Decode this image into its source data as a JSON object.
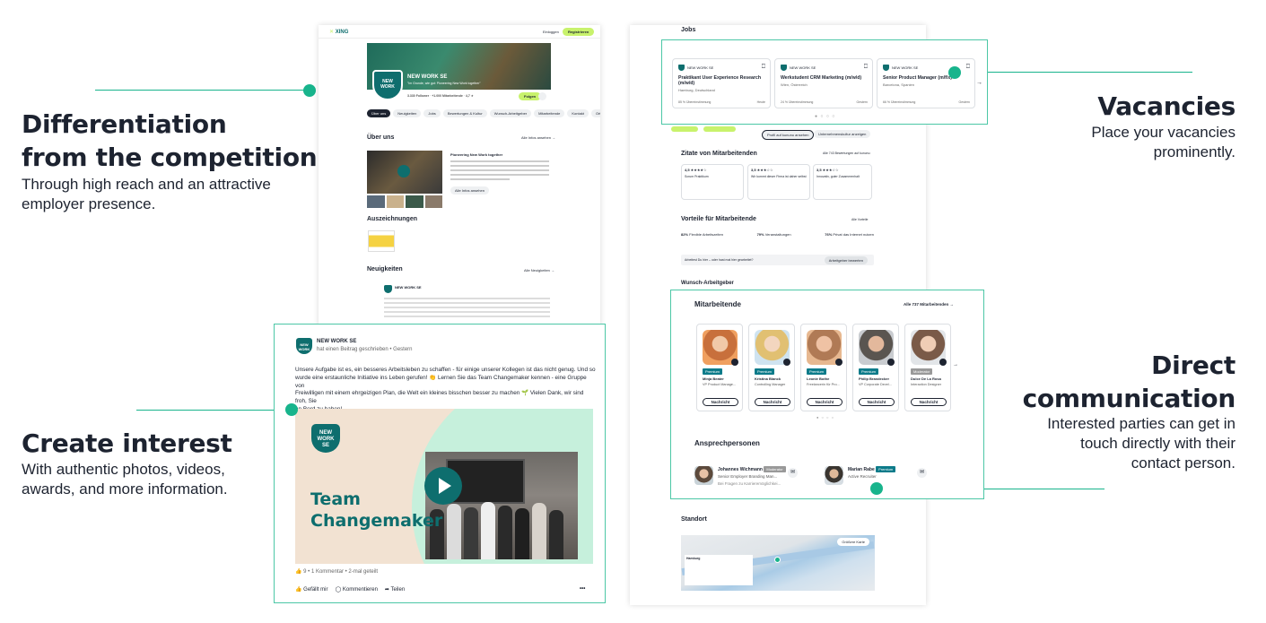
{
  "left_copy": {
    "differentiation": {
      "title_line1": "Differentiation",
      "title_line2": "from the competition",
      "sub_line1": "Through high reach and an attractive",
      "sub_line2": "employer presence."
    },
    "interest": {
      "title": "Create interest",
      "sub_line1": "With authentic photos, videos,",
      "sub_line2": "awards, and more information."
    }
  },
  "right_copy": {
    "vacancies": {
      "title": "Vacancies",
      "sub_line1": "Place your vacancies",
      "sub_line2": "prominently."
    },
    "direct": {
      "title_line1": "Direct",
      "title_line2": "communication",
      "sub_line1": "Interested parties can get in",
      "sub_line2": "touch directly with their",
      "sub_line3": "contact  person."
    }
  },
  "profile_page": {
    "logo": "XING",
    "login": "Einloggen",
    "register": "Registrieren",
    "company": "NEW WORK SE",
    "tagline": "\"Im Grunde, wie gut: Pioneering New Work together\"",
    "followers": "3.330 Follower",
    "employees": "+1.000 Mitarbeitende",
    "rating": "4,7",
    "follow": "Folgen",
    "tabs": [
      "Über uns",
      "Neuigkeiten",
      "Jobs",
      "Bewertungen & Kultur",
      "Wunsch-Arbeitgeber",
      "Mitarbeitende",
      "Kontakt",
      "Ort"
    ],
    "about_title": "Über uns",
    "about_link": "Alle Infos ansehen",
    "about_heading": "Pioneering New Work together",
    "about_more": "Alle Infos ansehen",
    "awards_title": "Auszeichnungen",
    "news_title": "Neuigkeiten",
    "news_link": "Alle Neuigkeiten",
    "news_author": "NEW WORK SE"
  },
  "post": {
    "author": "NEW WORK SE",
    "meta": "hat einen Beitrag geschrieben",
    "time": "Gestern",
    "body_line1": "Unsere Aufgabe ist es, ein besseres Arbeitsleben zu schaffen - für einige unserer Kollegen ist das nicht genug. Und so",
    "body_line2": "wurde eine erstaunliche Initiative ins Leben gerufen! 👏 Lernen Sie das Team Changemaker kennen - eine Gruppe von",
    "body_line3": "Freiwilligen mit einem ehrgeizigen Plan, die Welt ein kleines bisschen besser zu machen 🌱 Vielen Dank, wir sind froh, Sie",
    "body_line4": "an Bord zu haben!",
    "video_title_line1": "Team",
    "video_title_line2": "Changemaker",
    "logo_text_1": "NEW",
    "logo_text_2": "WORK",
    "logo_text_3": "SE",
    "reactions": "9",
    "comments": "1 Kommentar",
    "shares": "2-mal geteilt",
    "like": "Gefällt mir",
    "comment": "Kommentieren",
    "share": "Teilen",
    "more": "•••"
  },
  "right_page": {
    "jobs_title": "Jobs",
    "jobs_link": "Alle 74 Jobs",
    "jobs": [
      {
        "company": "NEW WORK SE",
        "title": "Praktikant User Experience Research (m/w/d)",
        "location": "Hamburg, Deutschland",
        "match": "85 % Übereinstimmung",
        "date": "Heute"
      },
      {
        "company": "NEW WORK SE",
        "title": "Werkstudent CRM Marketing (m/w/d)",
        "location": "Wien, Österreich",
        "match": "24 % Übereinstimmung",
        "date": "Gestern"
      },
      {
        "company": "NEW WORK SE",
        "title": "Senior Product Manager (m/f/x)",
        "location": "Barcelona, Spanien",
        "match": "66 % Übereinstimmung",
        "date": "Gestern"
      }
    ],
    "profile_btn": "Profil auf kununu ansehen",
    "culture_btn": "Unternehmenskultur anzeigen",
    "quotes_title": "Zitate von Mitarbeitenden",
    "quotes_link": "Alle 743 Bewertungen auf kununu",
    "quotes": [
      {
        "score": "4,5",
        "text": "Scrum Praktikum"
      },
      {
        "score": "3,5",
        "text": "Wir kommt dieser Firma ist daher selbst"
      },
      {
        "score": "3,5",
        "text": "Innovativ, guter Zusammenhalt"
      }
    ],
    "benefits_title": "Vorteile für Mitarbeitende",
    "benefits_link": "Alle Vorteile",
    "benefits": [
      {
        "pct": "82%",
        "label": "Flexible Arbeitszeiten"
      },
      {
        "pct": "79%",
        "label": "Veranstaltungen"
      },
      {
        "pct": "76%",
        "label": "Privat das Internet nutzen"
      }
    ],
    "employer_note": "Arbeitest Du hier – oder hast mal hier gearbeitet?",
    "employer_btn": "Arbeitgeber bewerten",
    "wish_title": "Wunsch-Arbeitgeber",
    "employees_title": "Mitarbeitende",
    "employees_link": "Alle 737 Mitarbeitenden",
    "employees": [
      {
        "name": "Minja Beater",
        "role": "VP Product Manage...",
        "badge": "Premium",
        "color": "#e9a160"
      },
      {
        "name": "Kristina Blanck",
        "role": "Controlling Manager",
        "badge": "Premium",
        "color": "#d8c08a"
      },
      {
        "name": "Leonie Bothe",
        "role": "Freelancerin für Pro...",
        "badge": "Premium",
        "color": "#d99a7e"
      },
      {
        "name": "Philip Brandecker",
        "role": "VP Corporate Devel...",
        "badge": "Premium",
        "color": "#7b8088"
      },
      {
        "name": "Dulce De La Rosa",
        "role": "Interaction Designer",
        "badge": "Moderator",
        "color": "#a88270"
      }
    ],
    "message_btn": "Nachricht",
    "contacts_title": "Ansprechpersonen",
    "contacts": [
      {
        "name": "Johannes Wichmann",
        "badge": "Moderator",
        "role": "Senior Employer Branding Man...",
        "note": "Bei Fragen zu Karrieremöglichkei..."
      },
      {
        "name": "Marian Rabe",
        "badge": "Premium",
        "role": "Active Recruiter",
        "note": ""
      }
    ],
    "location_title": "Standort",
    "map_city": "Hamburg",
    "map_btn": "Größere Karte"
  },
  "colors": {
    "accent": "#18b48c",
    "callout_border": "#4cc7a6",
    "brand_dark": "#0e6e6e",
    "headline": "#1d2330"
  }
}
